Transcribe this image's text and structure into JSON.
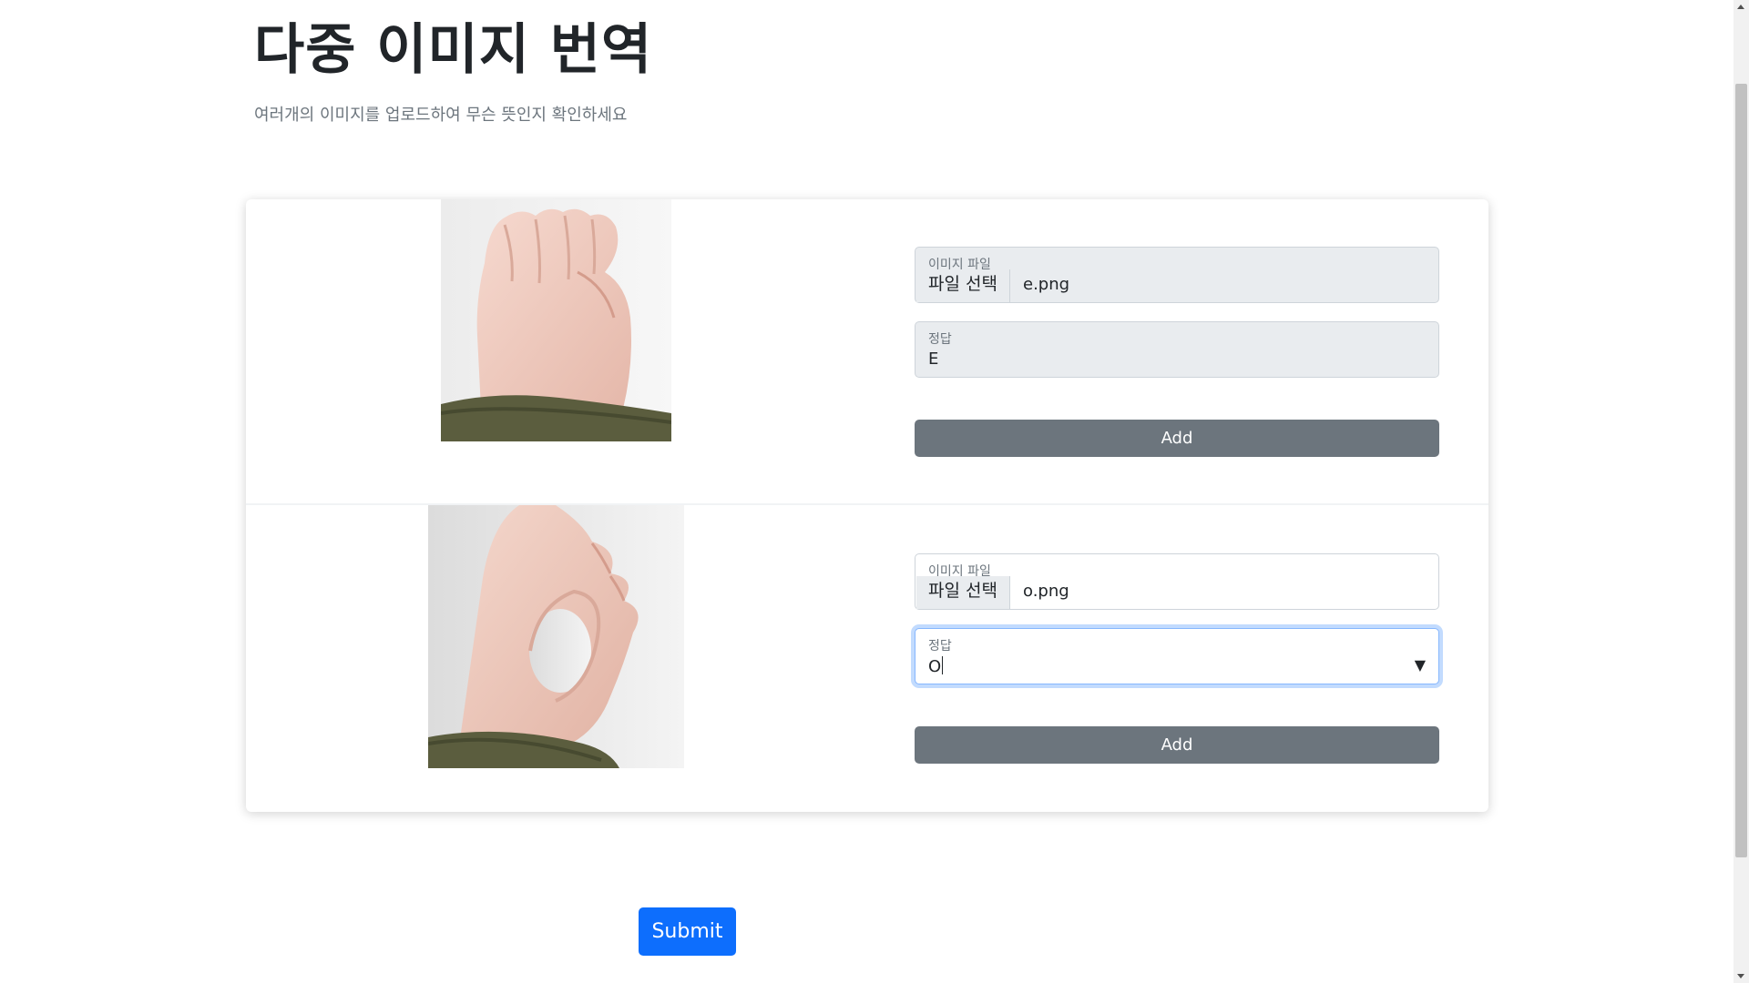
{
  "header": {
    "title": "다중 이미지 번역",
    "subtitle": "여러개의 이미지를 업로드하여 무슨 뜻인지 확인하세요"
  },
  "entries": [
    {
      "image_icon": "hand-sign-e",
      "file_label": "이미지 파일",
      "file_button": "파일 선택",
      "file_name": "e.png",
      "answer_label": "정답",
      "answer_value": "E",
      "add_label": "Add"
    },
    {
      "image_icon": "hand-sign-o",
      "file_label": "이미지 파일",
      "file_button": "파일 선택",
      "file_name": "o.png",
      "answer_label": "정답",
      "answer_value": "O",
      "select_caret": "▼",
      "add_label": "Add"
    }
  ],
  "submit_label": "Submit",
  "colors": {
    "primary": "#0d6efd",
    "secondary": "#6c757d",
    "disabled_bg": "#e9ecef",
    "focus_border": "#86b7fe"
  }
}
